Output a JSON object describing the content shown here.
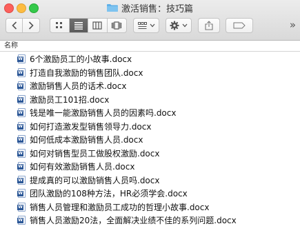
{
  "window": {
    "title": "激活销售：技巧篇"
  },
  "toolbar": {
    "back_icon": "chevron-left-icon",
    "forward_icon": "chevron-right-icon",
    "view_icons": [
      "icon-view-icon",
      "list-view-icon",
      "column-view-icon",
      "cover-flow-icon"
    ],
    "arrange_icon": "arrange-icon",
    "action_icon": "gear-icon",
    "share_icon": "share-icon",
    "tags_icon": "tag-icon",
    "overflow": "»"
  },
  "list": {
    "column_header": "名称",
    "files": [
      "6个激励员工的小故事.docx",
      "打造自我激励的销售团队.docx",
      "激励销售人员的话术.docx",
      "激励员工101招.docx",
      "钱是唯一能激励销售人员的因素吗.docx",
      "如何打造激发型销售领导力.docx",
      "如何低成本激励销售人员.docx",
      "如何对销售型员工做股权激励.docx",
      "如何有效激励销售人员.docx",
      "提成真的可以激励销售人员吗.docx",
      "团队激励的108种方法，HR必须学会.docx",
      "销售人员管理和激励员工成功的哲理小故事.docx",
      "销售人员激励20法，全面解决业绩不佳的系列问题.docx"
    ]
  },
  "colors": {
    "close": "#fc605c",
    "minimize": "#fdbc40",
    "zoom": "#34c84a",
    "folder": "#5fb0e8",
    "word_blue": "#2b5797"
  }
}
